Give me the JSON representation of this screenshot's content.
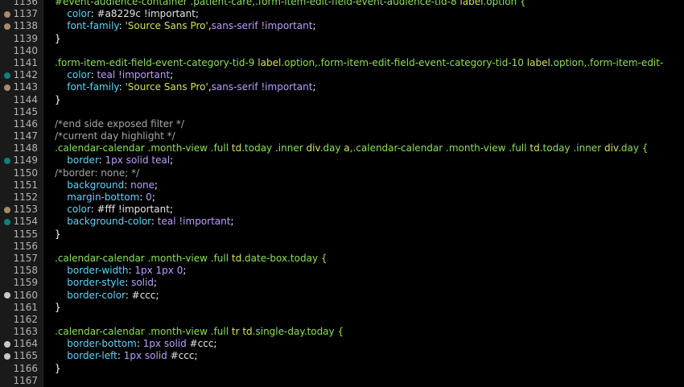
{
  "colors": {
    "background": "#000000",
    "gutter_background": "#1a1a1a",
    "line_number": "#b3b3b3",
    "selector_class": "#8be05a",
    "selector_tag": "#d6e05a",
    "property": "#5fd6ff",
    "value": "#e6e6e6",
    "color_value": "#c4a8ff",
    "keyword_value": "#bf9dff",
    "comment": "#a8a8a8",
    "punct": "#ffffff",
    "marker_tan": "#a8896c",
    "marker_teal": "#0f7f80",
    "marker_grey": "#c8c8c8"
  },
  "lines": [
    {
      "num": "1136",
      "marker": "",
      "segs": [
        {
          "t": "#event-audience-container .patient-care,.form-item-edit-field-event-audience-tid-8 ",
          "c": "selector_class"
        },
        {
          "t": "label",
          "c": "selector_tag"
        },
        {
          "t": ".option {",
          "c": "selector_class"
        }
      ]
    },
    {
      "num": "1137",
      "marker": "tan",
      "segs": [
        {
          "t": "    color",
          "c": "property"
        },
        {
          "t": ": ",
          "c": "punct"
        },
        {
          "t": "#a8229c !important",
          "c": "value"
        },
        {
          "t": ";",
          "c": "punct"
        }
      ]
    },
    {
      "num": "1138",
      "marker": "tan",
      "segs": [
        {
          "t": "    font-family",
          "c": "property"
        },
        {
          "t": ": ",
          "c": "punct"
        },
        {
          "t": "'Source Sans Pro'",
          "c": "selector_tag"
        },
        {
          "t": ",",
          "c": "punct"
        },
        {
          "t": "sans-serif !important",
          "c": "keyword_value"
        },
        {
          "t": ";",
          "c": "punct"
        }
      ]
    },
    {
      "num": "1139",
      "marker": "",
      "segs": [
        {
          "t": "}",
          "c": "punct"
        }
      ]
    },
    {
      "num": "1140",
      "marker": "",
      "segs": []
    },
    {
      "num": "1141",
      "marker": "",
      "segs": [
        {
          "t": ".form-item-edit-field-event-category-tid-9 ",
          "c": "selector_class"
        },
        {
          "t": "label",
          "c": "selector_tag"
        },
        {
          "t": ".option,.form-item-edit-field-event-category-tid-10 ",
          "c": "selector_class"
        },
        {
          "t": "label",
          "c": "selector_tag"
        },
        {
          "t": ".option,.form-item-edit-",
          "c": "selector_class"
        }
      ]
    },
    {
      "num": "1142",
      "marker": "teal",
      "segs": [
        {
          "t": "    color",
          "c": "property"
        },
        {
          "t": ": ",
          "c": "punct"
        },
        {
          "t": "teal !important",
          "c": "keyword_value"
        },
        {
          "t": ";",
          "c": "punct"
        }
      ]
    },
    {
      "num": "1143",
      "marker": "tan",
      "segs": [
        {
          "t": "    font-family",
          "c": "property"
        },
        {
          "t": ": ",
          "c": "punct"
        },
        {
          "t": "'Source Sans Pro'",
          "c": "selector_tag"
        },
        {
          "t": ",",
          "c": "punct"
        },
        {
          "t": "sans-serif !important",
          "c": "keyword_value"
        },
        {
          "t": ";",
          "c": "punct"
        }
      ]
    },
    {
      "num": "1144",
      "marker": "",
      "segs": [
        {
          "t": "}",
          "c": "punct"
        }
      ]
    },
    {
      "num": "1145",
      "marker": "",
      "segs": []
    },
    {
      "num": "1146",
      "marker": "",
      "segs": [
        {
          "t": "/*end side exposed filter */",
          "c": "comment"
        }
      ]
    },
    {
      "num": "1147",
      "marker": "",
      "segs": [
        {
          "t": "/*current day highlight */",
          "c": "comment"
        }
      ]
    },
    {
      "num": "1148",
      "marker": "",
      "segs": [
        {
          "t": ".calendar-calendar .month-view .full ",
          "c": "selector_class"
        },
        {
          "t": "td",
          "c": "selector_tag"
        },
        {
          "t": ".today .inner ",
          "c": "selector_class"
        },
        {
          "t": "div",
          "c": "selector_tag"
        },
        {
          "t": ".day ",
          "c": "selector_class"
        },
        {
          "t": "a",
          "c": "selector_tag"
        },
        {
          "t": ",.calendar-calendar .month-view .full ",
          "c": "selector_class"
        },
        {
          "t": "td",
          "c": "selector_tag"
        },
        {
          "t": ".today .inner ",
          "c": "selector_class"
        },
        {
          "t": "div",
          "c": "selector_tag"
        },
        {
          "t": ".day {",
          "c": "selector_class"
        }
      ]
    },
    {
      "num": "1149",
      "marker": "teal",
      "segs": [
        {
          "t": "    border",
          "c": "property"
        },
        {
          "t": ": ",
          "c": "punct"
        },
        {
          "t": "1px solid teal",
          "c": "keyword_value"
        },
        {
          "t": ";",
          "c": "punct"
        }
      ]
    },
    {
      "num": "1150",
      "marker": "",
      "segs": [
        {
          "t": "/*border: none; */",
          "c": "comment"
        }
      ]
    },
    {
      "num": "1151",
      "marker": "",
      "segs": [
        {
          "t": "    background",
          "c": "property"
        },
        {
          "t": ": ",
          "c": "punct"
        },
        {
          "t": "none",
          "c": "keyword_value"
        },
        {
          "t": ";",
          "c": "punct"
        }
      ]
    },
    {
      "num": "1152",
      "marker": "",
      "segs": [
        {
          "t": "    margin-bottom",
          "c": "property"
        },
        {
          "t": ": ",
          "c": "punct"
        },
        {
          "t": "0",
          "c": "keyword_value"
        },
        {
          "t": ";",
          "c": "punct"
        }
      ]
    },
    {
      "num": "1153",
      "marker": "tan",
      "segs": [
        {
          "t": "    color",
          "c": "property"
        },
        {
          "t": ": ",
          "c": "punct"
        },
        {
          "t": "#fff !important",
          "c": "value"
        },
        {
          "t": ";",
          "c": "punct"
        }
      ]
    },
    {
      "num": "1154",
      "marker": "teal",
      "segs": [
        {
          "t": "    background-color",
          "c": "property"
        },
        {
          "t": ": ",
          "c": "punct"
        },
        {
          "t": "teal !important",
          "c": "keyword_value"
        },
        {
          "t": ";",
          "c": "punct"
        }
      ]
    },
    {
      "num": "1155",
      "marker": "",
      "segs": [
        {
          "t": "}",
          "c": "punct"
        }
      ]
    },
    {
      "num": "1156",
      "marker": "",
      "segs": []
    },
    {
      "num": "1157",
      "marker": "",
      "segs": [
        {
          "t": ".calendar-calendar .month-view .full ",
          "c": "selector_class"
        },
        {
          "t": "td",
          "c": "selector_tag"
        },
        {
          "t": ".date-box.today {",
          "c": "selector_class"
        }
      ]
    },
    {
      "num": "1158",
      "marker": "",
      "segs": [
        {
          "t": "    border-width",
          "c": "property"
        },
        {
          "t": ": ",
          "c": "punct"
        },
        {
          "t": "1px 1px 0",
          "c": "keyword_value"
        },
        {
          "t": ";",
          "c": "punct"
        }
      ]
    },
    {
      "num": "1159",
      "marker": "",
      "segs": [
        {
          "t": "    border-style",
          "c": "property"
        },
        {
          "t": ": ",
          "c": "punct"
        },
        {
          "t": "solid",
          "c": "keyword_value"
        },
        {
          "t": ";",
          "c": "punct"
        }
      ]
    },
    {
      "num": "1160",
      "marker": "grey",
      "segs": [
        {
          "t": "    border-color",
          "c": "property"
        },
        {
          "t": ": ",
          "c": "punct"
        },
        {
          "t": "#ccc",
          "c": "value"
        },
        {
          "t": ";",
          "c": "punct"
        }
      ]
    },
    {
      "num": "1161",
      "marker": "",
      "segs": [
        {
          "t": "}",
          "c": "punct"
        }
      ]
    },
    {
      "num": "1162",
      "marker": "",
      "segs": []
    },
    {
      "num": "1163",
      "marker": "",
      "segs": [
        {
          "t": ".calendar-calendar .month-view .full ",
          "c": "selector_class"
        },
        {
          "t": "tr ",
          "c": "selector_tag"
        },
        {
          "t": "td",
          "c": "selector_tag"
        },
        {
          "t": ".single-day.today {",
          "c": "selector_class"
        }
      ]
    },
    {
      "num": "1164",
      "marker": "grey",
      "segs": [
        {
          "t": "    border-bottom",
          "c": "property"
        },
        {
          "t": ": ",
          "c": "punct"
        },
        {
          "t": "1px solid ",
          "c": "keyword_value"
        },
        {
          "t": "#ccc",
          "c": "value"
        },
        {
          "t": ";",
          "c": "punct"
        }
      ]
    },
    {
      "num": "1165",
      "marker": "grey",
      "segs": [
        {
          "t": "    border-left",
          "c": "property"
        },
        {
          "t": ": ",
          "c": "punct"
        },
        {
          "t": "1px solid ",
          "c": "keyword_value"
        },
        {
          "t": "#ccc",
          "c": "value"
        },
        {
          "t": ";",
          "c": "punct"
        }
      ]
    },
    {
      "num": "1166",
      "marker": "",
      "segs": [
        {
          "t": "}",
          "c": "punct"
        }
      ]
    },
    {
      "num": "1167",
      "marker": "",
      "segs": []
    }
  ]
}
